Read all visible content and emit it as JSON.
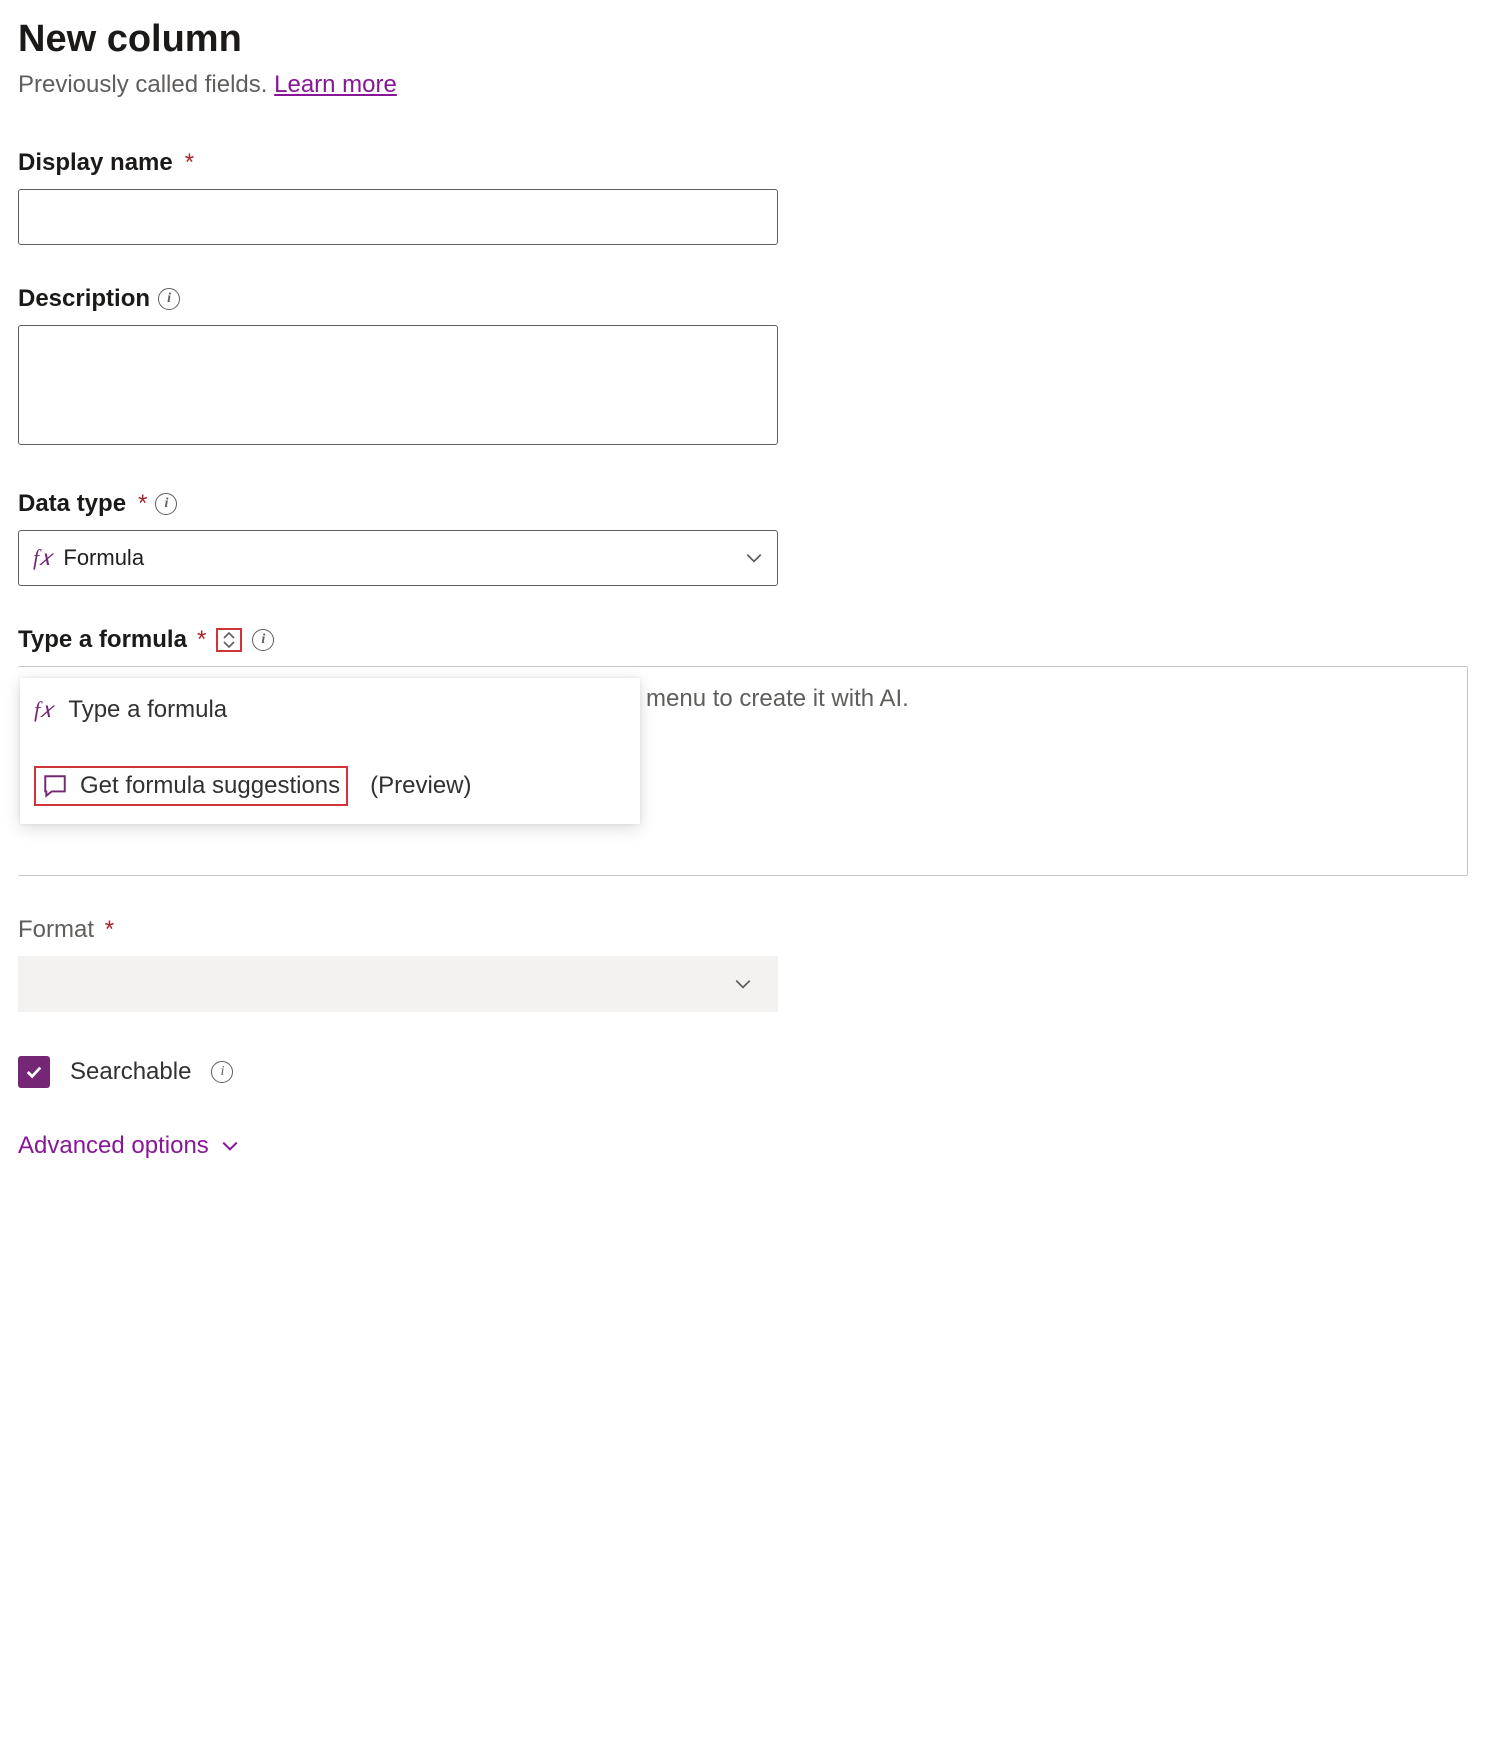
{
  "header": {
    "title": "New column",
    "subtitle_prefix": "Previously called fields. ",
    "learn_more": "Learn more"
  },
  "display_name": {
    "label": "Display name",
    "value": ""
  },
  "description": {
    "label": "Description",
    "value": ""
  },
  "data_type": {
    "label": "Data type",
    "selected": "Formula"
  },
  "formula": {
    "label": "Type a formula",
    "placeholder_suffix": "menu to create it with AI.",
    "menu": {
      "type_option": "Type a formula",
      "suggestions_option": "Get formula suggestions",
      "preview_tag": "(Preview)"
    }
  },
  "format": {
    "label": "Format",
    "selected": ""
  },
  "searchable": {
    "label": "Searchable",
    "checked": true
  },
  "advanced": {
    "label": "Advanced options"
  }
}
